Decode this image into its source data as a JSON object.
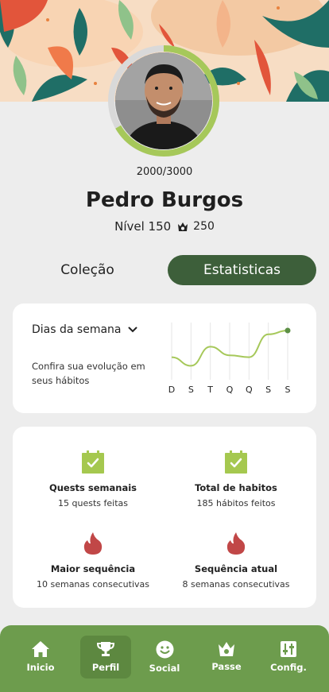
{
  "profile": {
    "xp_text": "2000/3000",
    "xp_progress": 0.667,
    "name": "Pedro Burgos",
    "level_text": "Nível 150",
    "coins": "250"
  },
  "tabs": [
    {
      "label": "Coleção",
      "active": false
    },
    {
      "label": "Estatisticas",
      "active": true
    }
  ],
  "week_card": {
    "dropdown_label": "Dias da semana",
    "description": "Confira sua evolução em seus hábitos"
  },
  "chart_data": {
    "type": "line",
    "categories": [
      "D",
      "S",
      "T",
      "Q",
      "Q",
      "S",
      "S"
    ],
    "values": [
      2.2,
      1.3,
      3.3,
      2.4,
      2.2,
      4.6,
      5.0
    ],
    "ylim": [
      0,
      5.5
    ],
    "grid": true,
    "color": "#a6c85a"
  },
  "stats": [
    {
      "title": "Quests semanais",
      "subtitle": "15 quests feitas",
      "icon": "calendar-check-icon"
    },
    {
      "title": "Total de habitos",
      "subtitle": "185 hábitos feitos",
      "icon": "calendar-check-icon"
    },
    {
      "title": "Maior sequência",
      "subtitle": "10 semanas consecutivas",
      "icon": "flame-icon"
    },
    {
      "title": "Sequência atual",
      "subtitle": "8 semanas consecutivas",
      "icon": "flame-icon"
    }
  ],
  "nav": [
    {
      "label": "Inicio",
      "icon": "home-icon",
      "active": false
    },
    {
      "label": "Perfil",
      "icon": "trophy-icon",
      "active": true
    },
    {
      "label": "Social",
      "icon": "smiley-icon",
      "active": false
    },
    {
      "label": "Passe",
      "icon": "crown-icon",
      "active": false
    },
    {
      "label": "Config.",
      "icon": "sliders-icon",
      "active": false
    }
  ],
  "colors": {
    "accent_dark": "#3d5f3a",
    "nav_green": "#6d9c4d",
    "progress_green": "#a6c85a",
    "check_green": "#a5c84f",
    "flame_red": "#c14747"
  }
}
